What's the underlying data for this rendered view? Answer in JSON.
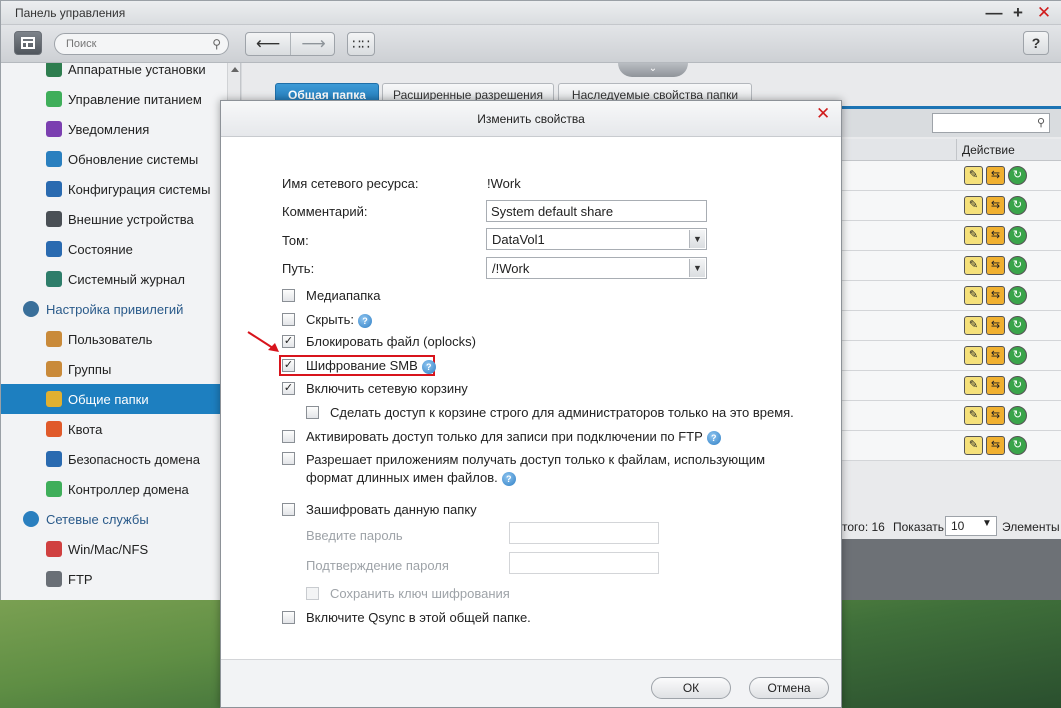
{
  "window": {
    "title": "Панель управления",
    "min_symbol": "—",
    "max_symbol": "+",
    "close_symbol": "✕"
  },
  "toolbar": {
    "search_placeholder": "Поиск",
    "back_symbol": "⟵",
    "forward_symbol": "⟶",
    "help_label": "?"
  },
  "sidebar": {
    "items": [
      {
        "label": "Аппаратные установки",
        "kind": "item",
        "icon": "hardware-icon",
        "color": "#2e7d4f"
      },
      {
        "label": "Управление питанием",
        "kind": "item",
        "icon": "power-icon",
        "color": "#3fae5a"
      },
      {
        "label": "Уведомления",
        "kind": "item",
        "icon": "notification-icon",
        "color": "#7b3fb0"
      },
      {
        "label": "Обновление системы",
        "kind": "item",
        "icon": "update-icon",
        "color": "#2a7fbf"
      },
      {
        "label": "Конфигурация системы",
        "kind": "item",
        "icon": "config-icon",
        "color": "#2a6ab0"
      },
      {
        "label": "Внешние устройства",
        "kind": "item",
        "icon": "external-device-icon",
        "color": "#4a4f55"
      },
      {
        "label": "Состояние",
        "kind": "item",
        "icon": "status-icon",
        "color": "#2a6ab0"
      },
      {
        "label": "Системный журнал",
        "kind": "item",
        "icon": "log-icon",
        "color": "#2e7d6a"
      },
      {
        "label": "Настройка привилегий",
        "kind": "group",
        "icon": "privilege-icon",
        "color": "#3a6f9a"
      },
      {
        "label": "Пользователь",
        "kind": "item",
        "icon": "user-icon",
        "color": "#c98a3a"
      },
      {
        "label": "Группы",
        "kind": "item",
        "icon": "groups-icon",
        "color": "#c98a3a"
      },
      {
        "label": "Общие папки",
        "kind": "item",
        "icon": "shared-folder-icon",
        "color": "#e0b030",
        "active": true
      },
      {
        "label": "Квота",
        "kind": "item",
        "icon": "quota-icon",
        "color": "#e05a2a"
      },
      {
        "label": "Безопасность домена",
        "kind": "item",
        "icon": "domain-security-icon",
        "color": "#2a6ab0"
      },
      {
        "label": "Контроллер домена",
        "kind": "item",
        "icon": "domain-controller-icon",
        "color": "#3fae5a"
      },
      {
        "label": "Сетевые службы",
        "kind": "group",
        "icon": "network-services-icon",
        "color": "#2a7fbf"
      },
      {
        "label": "Win/Mac/NFS",
        "kind": "item",
        "icon": "winmacnfs-icon",
        "color": "#d04040"
      },
      {
        "label": "FTP",
        "kind": "item",
        "icon": "ftp-icon",
        "color": "#6a6f76"
      }
    ]
  },
  "content": {
    "tabs": [
      {
        "label": "Общая папка",
        "active": true
      },
      {
        "label": "Расширенные разрешения"
      },
      {
        "label": "Наследуемые свойства папки"
      }
    ],
    "grid": {
      "action_header": "Действие",
      "row_count": 10
    },
    "pager": {
      "total": "того: 16",
      "show_label": "Показать",
      "page_size": "10",
      "items_label": "Элементы"
    }
  },
  "dialog": {
    "title": "Изменить свойства",
    "close_symbol": "✕",
    "fields": {
      "share_name_label": "Имя сетевого ресурса:",
      "share_name_value": "!Work",
      "comment_label": "Комментарий:",
      "comment_value": "System default share",
      "volume_label": "Том:",
      "volume_value": "DataVol1",
      "path_label": "Путь:",
      "path_value": "/!Work"
    },
    "checkboxes": {
      "media_folder": {
        "label": "Медиапапка",
        "checked": false
      },
      "hide": {
        "label": "Скрыть:",
        "checked": false
      },
      "oplocks": {
        "label": "Блокировать файл (oplocks)",
        "checked": true
      },
      "smb_encryption": {
        "label": "Шифрование SMB",
        "checked": true
      },
      "recycle_bin": {
        "label": "Включить сетевую корзину",
        "checked": true
      },
      "recycle_admin_only": {
        "label": "Сделать доступ к корзине строго для администраторов только на это время.",
        "checked": false
      },
      "ftp_write_only": {
        "label": "Активировать доступ только для записи при подключении по FTP",
        "checked": false
      },
      "long_names_line1": "Разрешает приложениям получать доступ только к файлам, использующим",
      "long_names_line2": "формат длинных имен файлов.",
      "encrypt_folder": {
        "label": "Зашифровать данную папку",
        "checked": false
      },
      "save_key": {
        "label": "Сохранить ключ шифрования",
        "checked": false
      },
      "qsync": {
        "label": "Включите Qsync в этой общей папке.",
        "checked": false
      }
    },
    "password_label": "Введите пароль",
    "confirm_password_label": "Подтверждение пароля",
    "ok_label": "ОК",
    "cancel_label": "Отмена"
  },
  "colors": {
    "accent": "#1d7fc0",
    "highlight": "#d8141c",
    "close_red": "#d01c1c"
  }
}
